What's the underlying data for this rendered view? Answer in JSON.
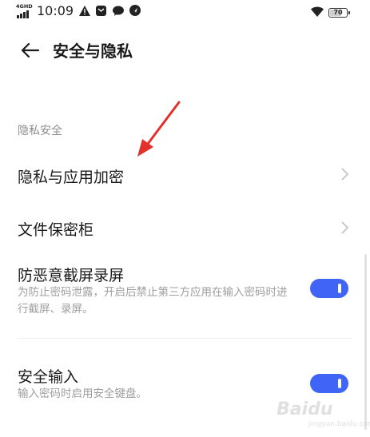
{
  "status_bar": {
    "network_label": "4GHD",
    "time": "10:09",
    "battery_level": "70",
    "icons": [
      "signal-icon",
      "alert-icon",
      "mail-icon",
      "chat-bubble-icon",
      "navigation-icon",
      "wifi-icon",
      "battery-icon"
    ]
  },
  "header": {
    "title": "安全与隐私",
    "back_icon": "arrow-left-icon"
  },
  "section": {
    "title": "隐私安全",
    "items": [
      {
        "label": "隐私与应用加密",
        "type": "link",
        "icon": "chevron-right-icon"
      },
      {
        "label": "文件保密柜",
        "type": "link",
        "icon": "chevron-right-icon"
      },
      {
        "label": "防恶意截屏录屏",
        "type": "toggle",
        "toggled": true,
        "desc": "为防止密码泄露，开启后禁止第三方应用在输入密码时进行截屏、录屏。"
      },
      {
        "label": "安全输入",
        "type": "toggle",
        "toggled": true,
        "desc": "输入密码时启用安全键盘。"
      }
    ]
  },
  "colors": {
    "accent": "#4064f5",
    "annotation_arrow": "#e2312a",
    "secondary_text": "#9e9e9e"
  },
  "watermark": {
    "logo": "Baidu",
    "sub": "jingyan.baidu.com"
  }
}
